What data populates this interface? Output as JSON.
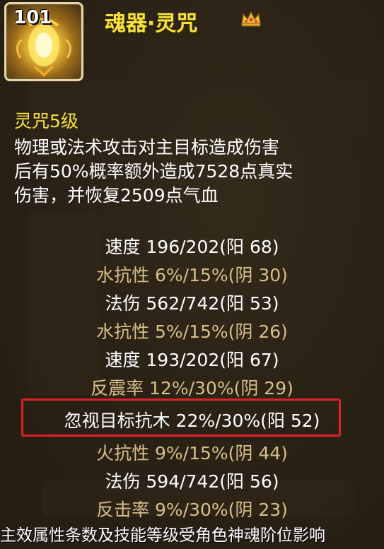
{
  "header": {
    "level_badge": "101",
    "item_name": "魂器·灵咒",
    "icon": "golden-lantern-artifact",
    "crown_icon": "crown-icon"
  },
  "skill": {
    "title": "灵咒5级",
    "description_lines": [
      "物理或法术攻击对主目标造成伤害",
      "后有50%概率额外造成7528点真实",
      "伤害，并恢复2509点气血"
    ]
  },
  "stats": [
    {
      "text": "速度 196/202(阳 68)",
      "color": "white"
    },
    {
      "text": "水抗性 6%/15%(阴 30)",
      "color": "tan"
    },
    {
      "text": "法伤 562/742(阳 53)",
      "color": "white"
    },
    {
      "text": "水抗性 5%/15%(阴 26)",
      "color": "tan"
    },
    {
      "text": "速度 193/202(阳 67)",
      "color": "white"
    },
    {
      "text": "反震率 12%/30%(阴 29)",
      "color": "tan"
    },
    {
      "text": "忽视目标抗木 22%/30%(阳 52)",
      "color": "white",
      "highlighted": true
    },
    {
      "text": "火抗性 9%/15%(阴 44)",
      "color": "tan"
    },
    {
      "text": "法伤 594/742(阳 56)",
      "color": "white"
    },
    {
      "text": "反击率 9%/30%(阴 23)",
      "color": "tan"
    }
  ],
  "footer": "主效属性条数及技能等级受角色神魂阶位影响",
  "colors": {
    "title_yellow": "#f6e23c",
    "attr_tan": "#d7bf86",
    "highlight_red": "#e0202a"
  }
}
